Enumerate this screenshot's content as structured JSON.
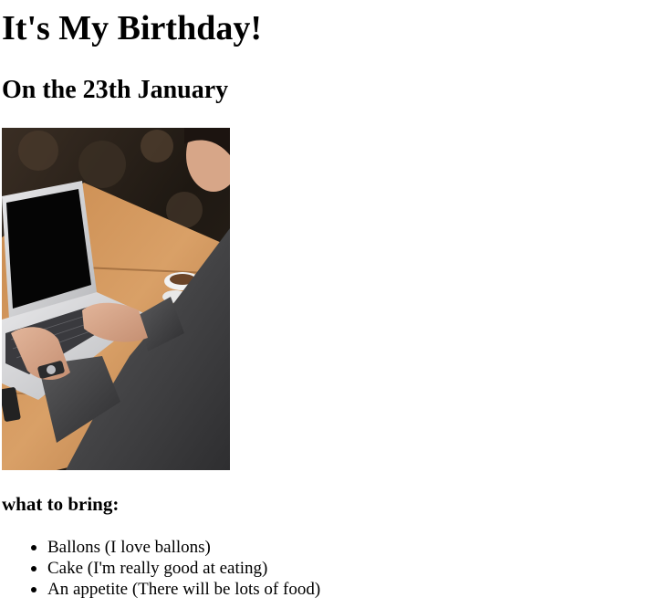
{
  "heading": {
    "title": "It's My Birthday!",
    "date": "On the 23th January"
  },
  "image": {
    "subject": "person-typing-on-laptop-photo"
  },
  "bring_section": {
    "label": "what to bring:",
    "items": [
      "Ballons (I love ballons)",
      "Cake (I'm really good at eating)",
      "An appetite (There will be lots of food)"
    ]
  }
}
